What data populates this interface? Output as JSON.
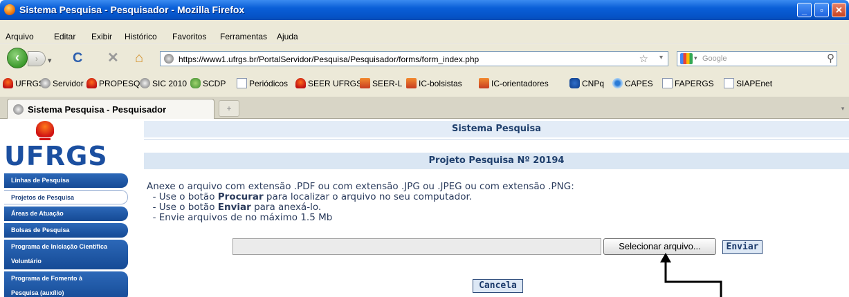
{
  "window": {
    "title": "Sistema Pesquisa - Pesquisador - Mozilla Firefox",
    "min": "_",
    "max": "▫",
    "close": "✕"
  },
  "menu": [
    "Arquivo",
    "Editar",
    "Exibir",
    "Histórico",
    "Favoritos",
    "Ferramentas",
    "Ajuda"
  ],
  "nav": {
    "back": "‹",
    "forward": "›",
    "reload": "C",
    "stop": "✕",
    "home": "⌂",
    "url": "https://www1.ufrgs.br/PortalServidor/Pesquisa/Pesquisador/forms/form_index.php",
    "star": "☆",
    "dropdown": "▾",
    "search_placeholder": "Google",
    "search_dropdown": "▾",
    "search_icon": "⚲"
  },
  "bookmarks": [
    "UFRGS",
    "Servidor",
    "PROPESQ",
    "SIC 2010",
    "SCDP",
    "Periódicos",
    "SEER UFRGS",
    "SEER-L",
    "IC-bolsistas",
    "IC-orientadores",
    "CNPq",
    "CAPES",
    "FAPERGS",
    "SIAPEnet"
  ],
  "tab": {
    "label": "Sistema Pesquisa - Pesquisador",
    "new_tab": "+",
    "scroll": "▾"
  },
  "logo": {
    "text": "UFRGS"
  },
  "sidebar": {
    "items": [
      {
        "label": "Linhas de Pesquisa"
      },
      {
        "label": "Projetos de Pesquisa"
      },
      {
        "label": "Áreas de Atuação"
      },
      {
        "label": "Bolsas de Pesquisa"
      },
      {
        "label1": "Programa de Iniciação Científica",
        "label2": "Voluntário"
      },
      {
        "label1": "Programa de Fomento à",
        "label2": "Pesquisa (auxílio)"
      }
    ]
  },
  "page": {
    "system_header": "Sistema Pesquisa",
    "project_header": "Projeto Pesquisa Nº 20194",
    "instructions": {
      "intro": "Anexe o arquivo com extensão .PDF ou com extensão .JPG ou .JPEG ou com extensão .PNG:",
      "l1_pre": "  - Use o botão ",
      "l1_bold": "Procurar",
      "l1_post": " para localizar o arquivo no seu computador.",
      "l2_pre": "  - Use o botão ",
      "l2_bold": "Enviar",
      "l2_post": " para anexá-lo.",
      "l3": "  - Envie arquivos de no máximo 1.5 Mb"
    },
    "select_button": "Selecionar arquivo...",
    "send_button": "Enviar",
    "cancel_button": "Cancela"
  },
  "colors": {
    "accent": "#1b4fa0",
    "header_bg": "#dae6f3",
    "titlebar": "#0a5fd8"
  }
}
